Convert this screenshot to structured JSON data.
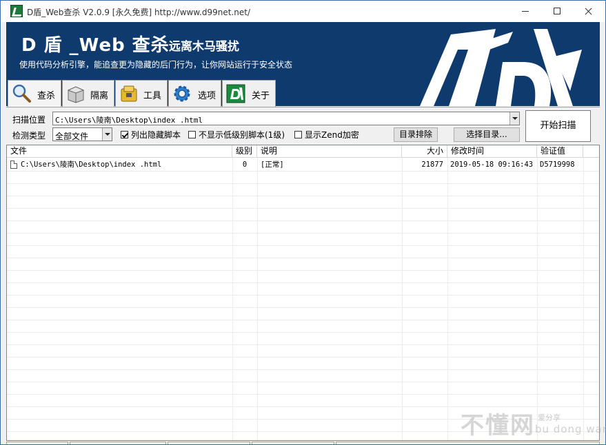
{
  "window": {
    "title": "D盾_Web查杀 V2.0.9 [永久免费] http://www.d99net.net/"
  },
  "banner": {
    "title": "D 盾 _Web 查杀",
    "slogan": "远离木马骚扰",
    "subtitle": "使用代码分析引擎，能追查更为隐藏的后门行为，让你网站运行于安全状态",
    "background_color": "#0f3a6e"
  },
  "tabs": [
    {
      "label": "查杀",
      "icon": "magnifier-icon",
      "active": true
    },
    {
      "label": "隔离",
      "icon": "box-icon",
      "active": false
    },
    {
      "label": "工具",
      "icon": "folder-tool-icon",
      "active": false
    },
    {
      "label": "选项",
      "icon": "gear-icon",
      "active": false
    },
    {
      "label": "关于",
      "icon": "d-logo-icon",
      "active": false
    }
  ],
  "controls": {
    "scan_path_label": "扫描位置",
    "scan_path_value": "C:\\Users\\陵南\\Desktop\\index .html",
    "detect_type_label": "检测类型",
    "detect_type_value": "全部文件",
    "opt_list_hidden": {
      "label": "列出隐藏脚本",
      "checked": true
    },
    "opt_hide_low": {
      "label": "不显示低级别脚本(1级)",
      "checked": false
    },
    "opt_show_zend": {
      "label": "显示Zend加密",
      "checked": false
    },
    "dir_exclude_button": "目录排除",
    "select_dir_button": "选择目录...",
    "start_scan_button": "开始扫描"
  },
  "table": {
    "columns": [
      "文件",
      "级别",
      "说明",
      "大小",
      "修改时间",
      "验证值"
    ],
    "rows": [
      {
        "file": "C:\\Users\\陵南\\Desktop\\index .html",
        "level": "0",
        "desc": "[正常]",
        "size": "21877",
        "mtime": "2019-05-18 09:16:43",
        "hash": "D5719998"
      }
    ]
  },
  "watermark": {
    "main": "不懂网",
    "small": "爱分享",
    "pinyin": "bu dong wang"
  }
}
